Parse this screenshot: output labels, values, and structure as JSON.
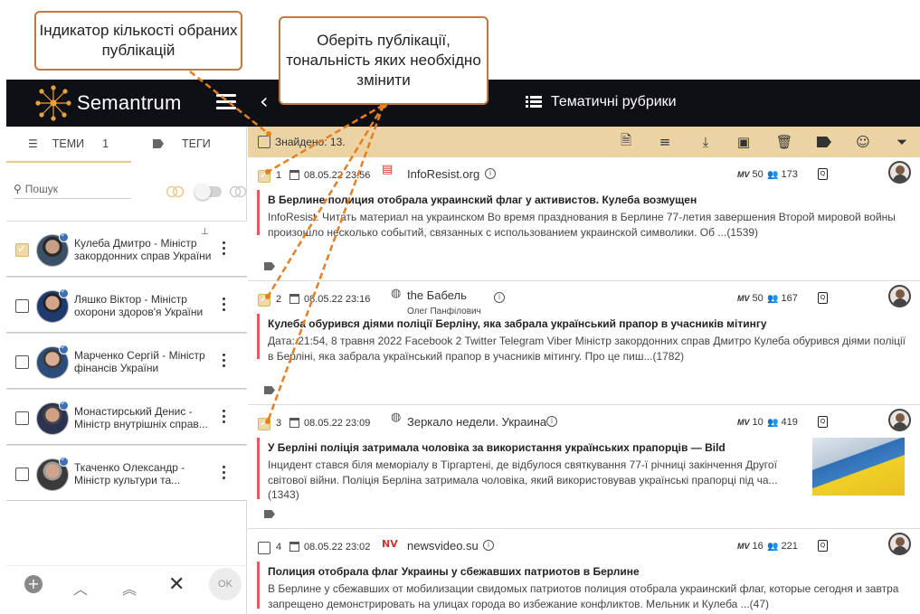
{
  "annotations": {
    "counter_callout": "Індикатор кількості обраних публікацій",
    "select_callout": "Оберіть публікації, тональність яких необхідно змінити"
  },
  "header": {
    "brand": "Semantrum",
    "back_icon": "chevron-left-icon",
    "menu_icon": "hamburger-icon",
    "section_title": "Тематичні рубрики",
    "section_icon": "list-icon",
    "bg_color": "#0f0f16"
  },
  "left_panel": {
    "tabs": [
      {
        "label": "ТЕМИ",
        "count": "1",
        "icon": "list-icon"
      },
      {
        "label": "ТЕГИ",
        "icon": "tag-icon"
      }
    ],
    "search_placeholder": "Пошук",
    "topics": [
      {
        "name": "Кулеба Дмитро - Міністр закордонних справ України",
        "checked": true,
        "pinned": true
      },
      {
        "name": "Ляшко Віктор - Міністр охорони здоров'я України",
        "checked": false
      },
      {
        "name": "Марченко Сергій - Міністр фінансів України",
        "checked": false
      },
      {
        "name": "Монастирський Денис - Міністр внутрішніх справ...",
        "checked": false
      },
      {
        "name": "Ткаченко Олександр - Міністр культури та...",
        "checked": false
      }
    ],
    "bottom": {
      "ok_label": "OK"
    }
  },
  "toolbar": {
    "found_text": "Знайдено: 13.",
    "accent_color": "#ecd3a3"
  },
  "publications": [
    {
      "num": "1",
      "date": "08.05.22 23:56",
      "source": "InfoResist.org",
      "author": "",
      "mv": "50",
      "audience": "173",
      "checked": true,
      "title": "В Берлине полиция отобрала украинский флаг у активистов. Кулеба возмущен",
      "body": "InfoResist. Читать материал на украинском Во время празднования в Берлине 77-летия завершения Второй мировой войны произошло несколько событий, связанных с использованием украинской символики. Об ...(1539)"
    },
    {
      "num": "2",
      "date": "08.05.22 23:16",
      "source": "the Бабель",
      "author": "Олег Панфілович",
      "mv": "50",
      "audience": "167",
      "checked": true,
      "title": "Кулеба обурився діями поліції Берліну, яка забрала український прапор в учасників мітингу",
      "body": "Дата: 21:54, 8 травня 2022 Facebook 2 Twitter Telegram Viber Міністр закордонних справ Дмитро Кулеба обурився діями поліції в Берліні, яка забрала український прапор в учасників мітингу. Про це пиш...(1782)"
    },
    {
      "num": "3",
      "date": "08.05.22 23:09",
      "source": "Зеркало недели. Украина",
      "author": "",
      "mv": "10",
      "audience": "419",
      "checked": true,
      "title": "У Берліні поліція затримала чоловіка за використання українських прапорців — Bild",
      "body": "Інцидент стався біля меморіалу в Тіргартені, де відбулося святкування 77-ї річниці закінчення Другої світової війни. Поліція Берліна затримала чоловіка, який використовував українські прапорці під ча... (1343)"
    },
    {
      "num": "4",
      "date": "08.05.22 23:02",
      "source": "newsvideo.su",
      "author": "",
      "mv": "16",
      "audience": "221",
      "checked": false,
      "title": "Полиция отобрала флаг Украины у сбежавших патриотов в Берлине",
      "body": "В Берлине у сбежавших от мобилизации свидомых патриотов полиция отобрала украинский флаг, которые сегодня и завтра запрещено демонстрировать на улицах города во избежание конфликтов. Мельник и Кулеба ...(47)"
    }
  ],
  "labels": {
    "mv_prefix": "MV"
  }
}
